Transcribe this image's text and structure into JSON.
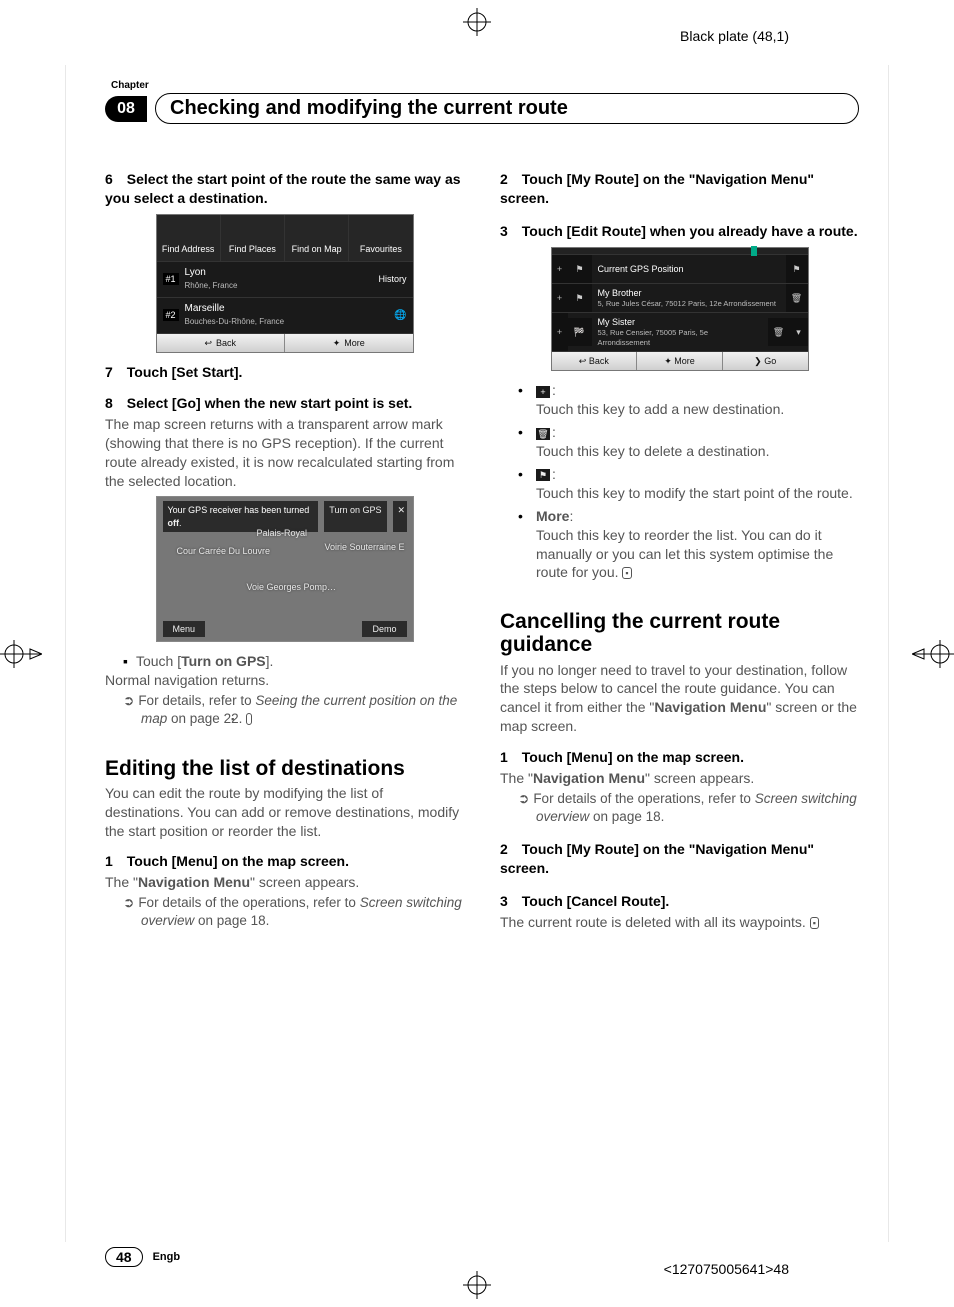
{
  "meta": {
    "black_plate": "Black plate (48,1)",
    "bottom_code": "<127075005641>48"
  },
  "header": {
    "chapter_label": "Chapter",
    "chapter_num": "08",
    "title": "Checking and modifying the current route"
  },
  "left": {
    "step6": "Select the start point of the route the same way as you select a destination.",
    "shot1": {
      "tabs": [
        "Find Address",
        "Find Places",
        "Find on Map",
        "Favourites"
      ],
      "history": "History",
      "row1_idx": "#1",
      "row1_t1": "Lyon",
      "row1_t2": "Rhône, France",
      "row2_idx": "#2",
      "row2_t1": "Marseille",
      "row2_t2": "Bouches-Du-Rhône, France",
      "btn_back": "Back",
      "btn_more": "More"
    },
    "step7": "Touch [Set Start].",
    "step8_head": "Select [Go] when the new start point is set.",
    "step8_body": "The map screen returns with a transparent arrow mark (showing that there is no GPS reception). If the current route already existed, it is now recalculated starting from the selected location.",
    "shot2": {
      "topmsg": "Your GPS receiver has been turned off.",
      "topbtn": "Turn on GPS",
      "lbl1": "Cour Carrée Du Louvre",
      "lbl2": "Voirie Souterraine E",
      "lbl3": "Voie Georges Pomp…",
      "lbl4": "Palais-Royal",
      "menu": "Menu",
      "demo": "Demo"
    },
    "turn_on_gps_line": "Touch [Turn on GPS].",
    "turn_on_gps_strong": "Turn on GPS",
    "normal_nav": "Normal navigation returns.",
    "ref1a": "For details, refer to ",
    "ref1b": "Seeing the current position on the map",
    "ref1c": " on page 22.",
    "h2_editing": "Editing the list of destinations",
    "editing_body": "You can edit the route by modifying the list of destinations. You can add or remove destinations, modify the start position or reorder the list.",
    "s1": "Touch [Menu] on the map screen.",
    "s1_after_a": "The \"",
    "s1_after_b": "Navigation Menu",
    "s1_after_c": "\" screen appears.",
    "s1_ref_a": "For details of the operations, refer to ",
    "s1_ref_b": "Screen switching overview",
    "s1_ref_c": " on page 18."
  },
  "right": {
    "s2": "Touch [My Route] on the \"Navigation Menu\" screen.",
    "s3": "Touch [Edit Route] when you already have a route.",
    "shot3": {
      "r1": "Current GPS Position",
      "r2_t1": "My Brother",
      "r2_t2": "5, Rue Jules César, 75012 Paris, 12e Arrondissement",
      "r3_t1": "My Sister",
      "r3_t2": "53, Rue Censier, 75005 Paris, 5e Arrondissement",
      "b_back": "Back",
      "b_more": "More",
      "b_go": "Go"
    },
    "li1": "Touch this key to add a new destination.",
    "li2": "Touch this key to delete a destination.",
    "li3": "Touch this key to modify the start point of the route.",
    "li4_head": "More",
    "li4_body": "Touch this key to reorder the list. You can do it manually or you can let this system optimise the route for you.",
    "h2_cancel": "Cancelling the current route guidance",
    "cancel_body_a": "If you no longer need to travel to your destination, follow the steps below to cancel the route guidance. You can cancel it from either the \"",
    "cancel_body_b": "Navigation Menu",
    "cancel_body_c": "\" screen or the map screen.",
    "c1": "Touch [Menu] on the map screen.",
    "c1_after_a": "The \"",
    "c1_after_b": "Navigation Menu",
    "c1_after_c": "\" screen appears.",
    "c1_ref_a": "For details of the operations, refer to ",
    "c1_ref_b": "Screen switching overview",
    "c1_ref_c": " on page 18.",
    "c2": "Touch [My Route] on the \"Navigation Menu\" screen.",
    "c3": "Touch [Cancel Route].",
    "c3_after": "The current route is deleted with all its waypoints."
  },
  "footer": {
    "page": "48",
    "lang": "Engb"
  }
}
